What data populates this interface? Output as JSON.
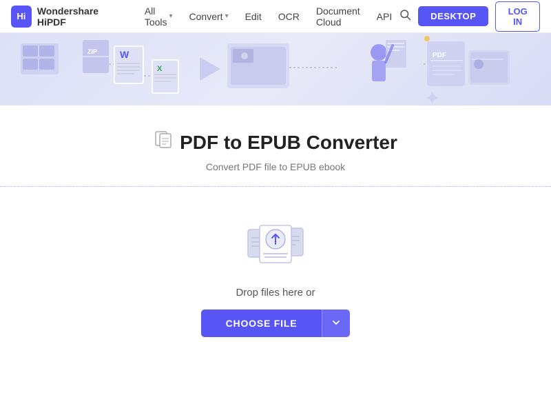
{
  "nav": {
    "logo_text": "Wondershare HiPDF",
    "logo_abbr": "Hi",
    "links": [
      {
        "label": "All Tools",
        "has_dropdown": true
      },
      {
        "label": "Convert",
        "has_dropdown": true
      },
      {
        "label": "Edit",
        "has_dropdown": false
      },
      {
        "label": "OCR",
        "has_dropdown": false
      },
      {
        "label": "Document Cloud",
        "has_dropdown": false
      },
      {
        "label": "API",
        "has_dropdown": false
      }
    ],
    "desktop_btn": "DESKTOP",
    "login_btn": "LOG IN"
  },
  "page": {
    "title": "PDF to EPUB Converter",
    "subtitle": "Convert PDF file to EPUB ebook",
    "drop_text": "Drop files here or",
    "choose_file_btn": "CHOOSE FILE"
  }
}
